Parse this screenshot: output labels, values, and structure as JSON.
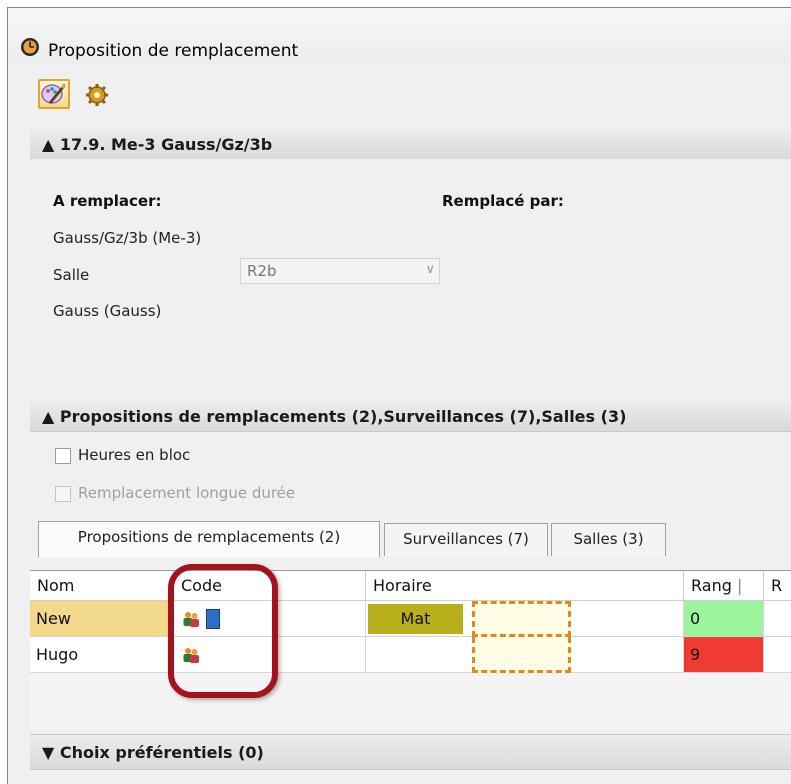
{
  "window": {
    "title": "Proposition de remplacement"
  },
  "toolbar": {
    "buttons": [
      {
        "name": "settings-brush-icon"
      },
      {
        "name": "gear-icon"
      }
    ]
  },
  "section1": {
    "header": "▲ 17.9. Me-3 Gauss/Gz/3b"
  },
  "details": {
    "a_remplacer_label": "A remplacer:",
    "remplace_par_label": "Remplacé par:",
    "lesson": "Gauss/Gz/3b (Me-3)",
    "salle_label": "Salle",
    "salle_value": "R2b",
    "teacher": "Gauss (Gauss)"
  },
  "section2": {
    "header": "▲ Propositions de remplacements (2),Surveillances (7),Salles (3)"
  },
  "options": {
    "heures_en_bloc": "Heures en bloc",
    "remplacement_longue_duree": "Remplacement longue durée"
  },
  "tabs": [
    {
      "label": "Propositions de remplacements (2)"
    },
    {
      "label": "Surveillances (7)"
    },
    {
      "label": "Salles (3)"
    }
  ],
  "grid": {
    "columns": [
      "Nom",
      "Code",
      "Horaire",
      "Rang",
      "R"
    ],
    "rows": [
      {
        "nom": "New",
        "horaire": "Mat",
        "rang": "0"
      },
      {
        "nom": "Hugo",
        "horaire": "",
        "rang": "9"
      }
    ]
  },
  "section3": {
    "header": "▼ Choix préférentiels (0)"
  },
  "colors": {
    "accent": "#e2a52b",
    "ring": "#a4141d",
    "rank_good": "#9cf59c",
    "rank_bad": "#ef3b32",
    "mat": "#b7b01c",
    "selected_row": "#f2d98c"
  }
}
